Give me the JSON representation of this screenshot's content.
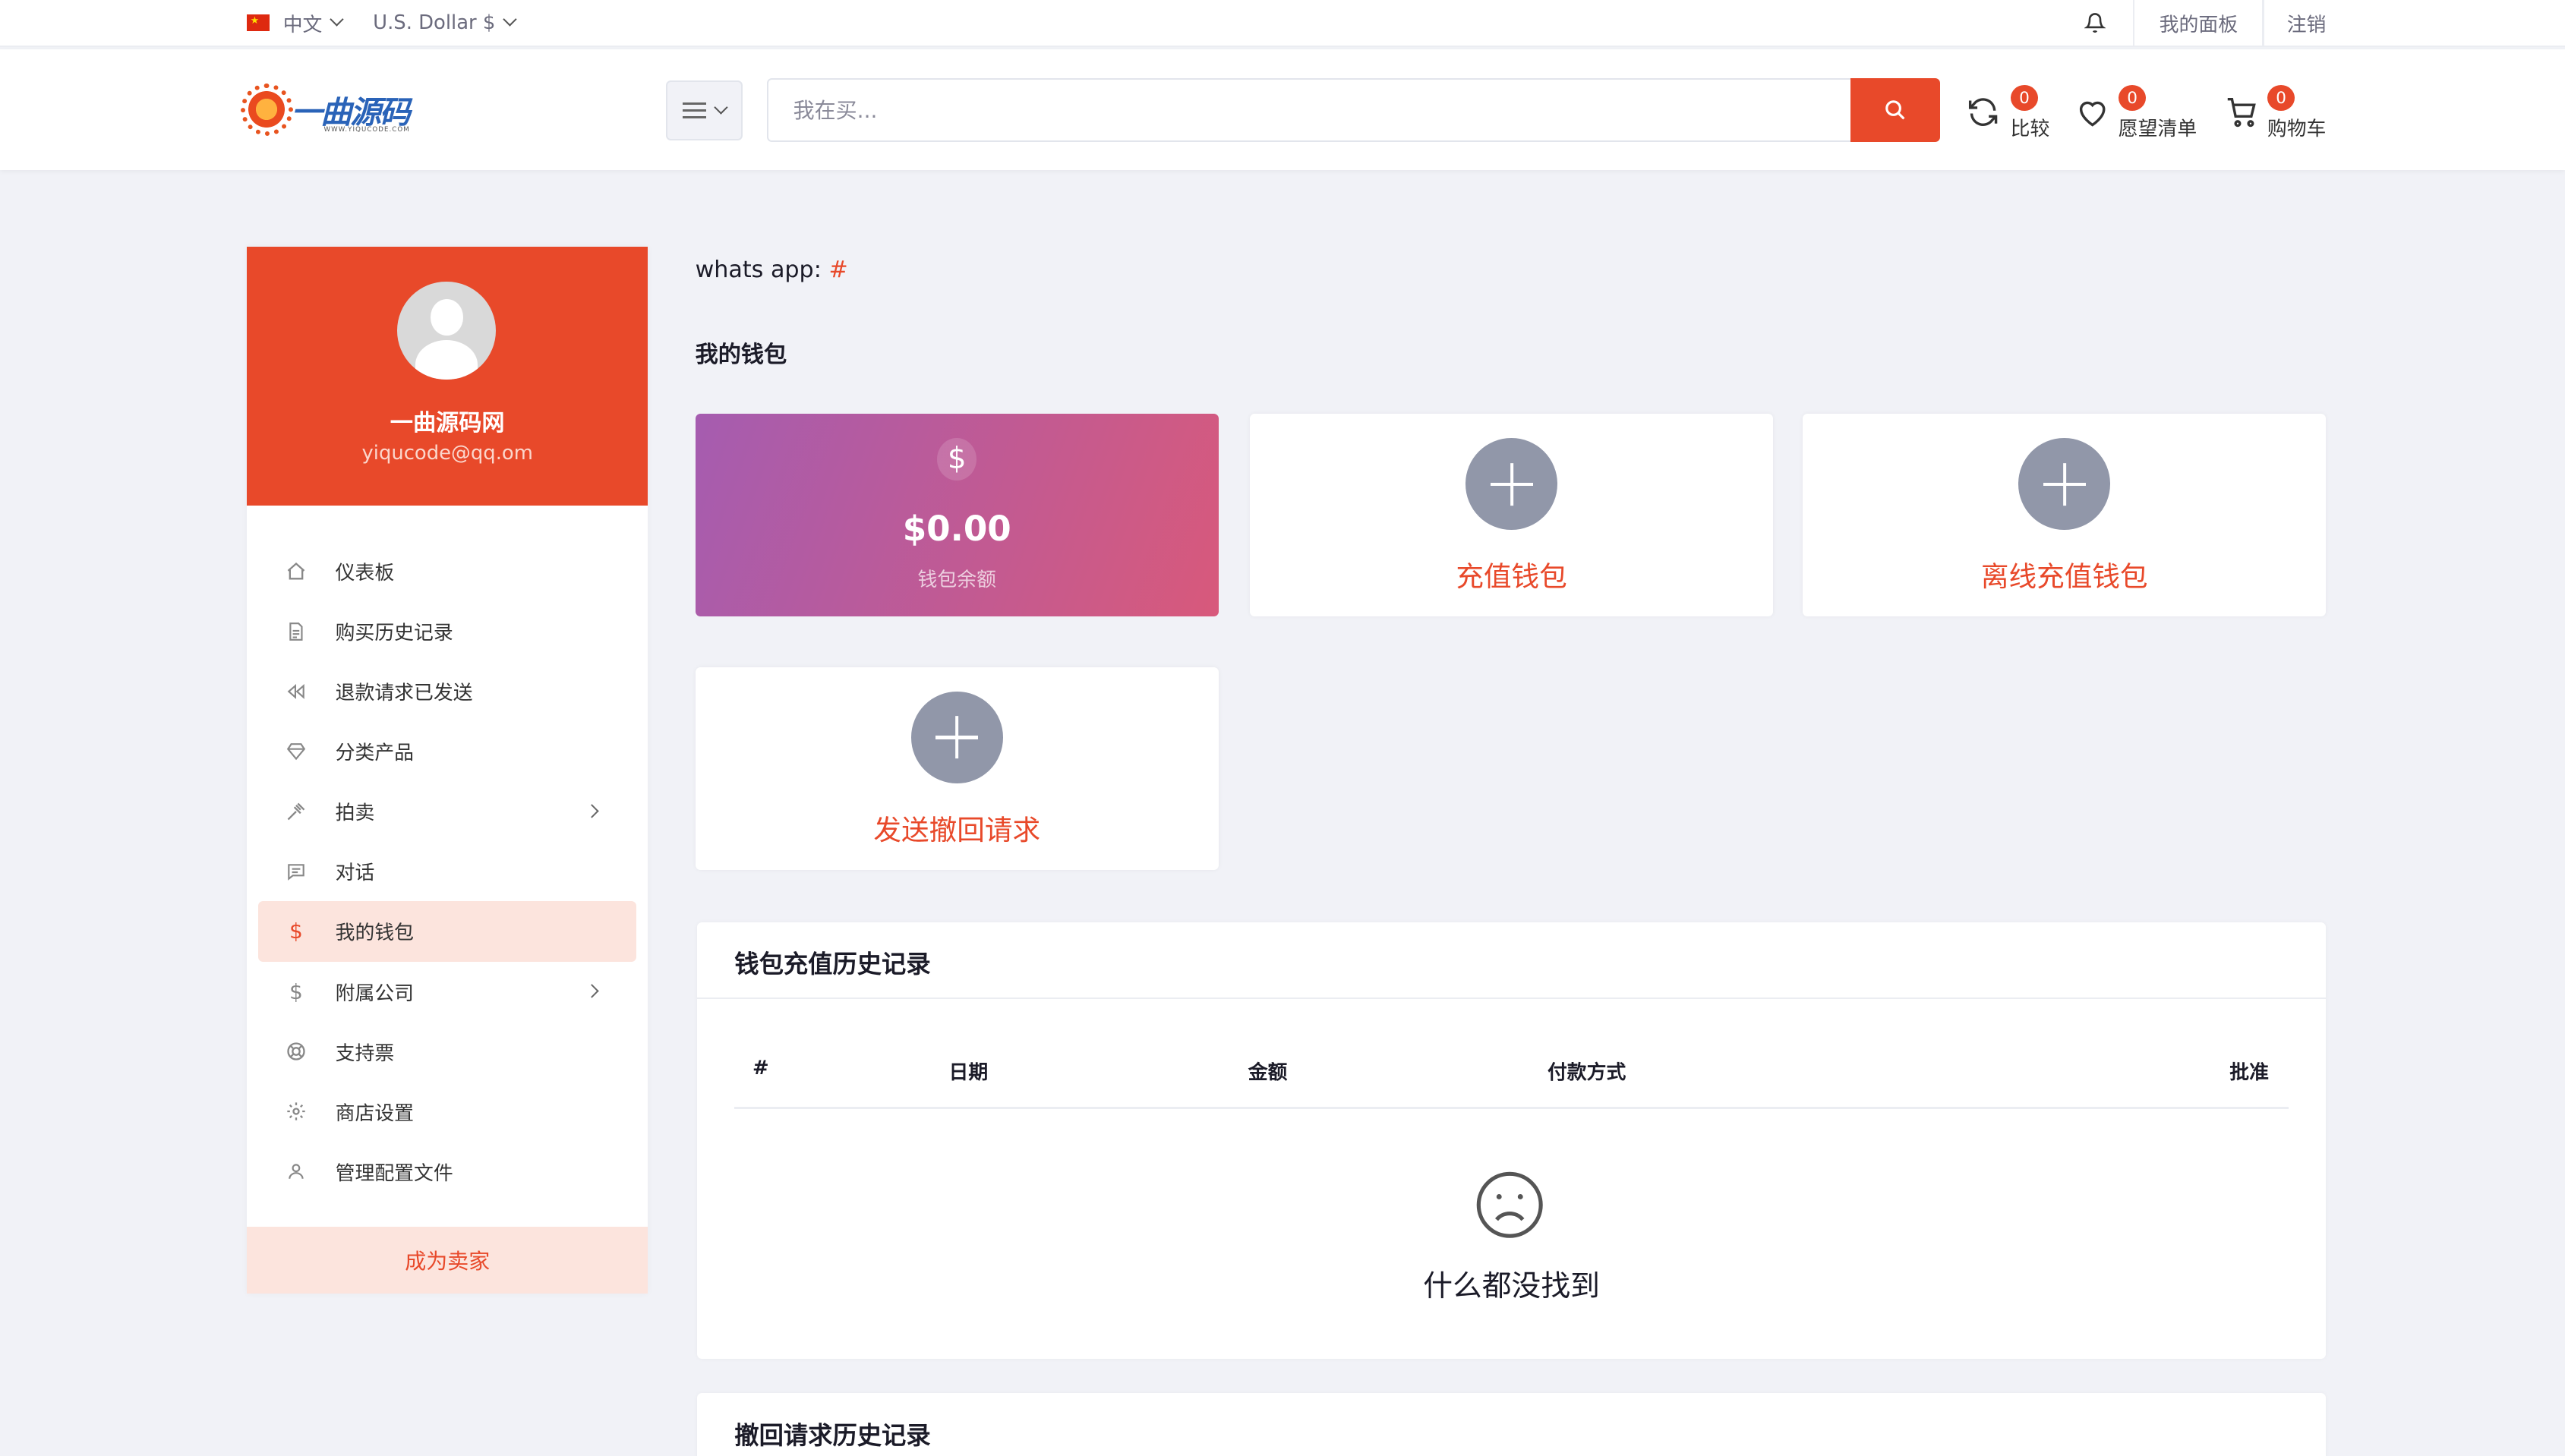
{
  "topbar": {
    "language": "中文",
    "currency": "U.S. Dollar $",
    "dashboard_link": "我的面板",
    "logout_link": "注销"
  },
  "header": {
    "logo_text": "一曲源码",
    "logo_sub": "WWW.YIQUCODE.COM",
    "search_placeholder": "我在买...",
    "compare": {
      "count": "0",
      "label": "比较"
    },
    "wishlist": {
      "count": "0",
      "label": "愿望清单"
    },
    "cart": {
      "count": "0",
      "label": "购物车"
    }
  },
  "sidebar": {
    "user_name": "一曲源码网",
    "user_email": "yiqucode@qq.om",
    "items": [
      {
        "label": "仪表板",
        "icon": "home-icon"
      },
      {
        "label": "购买历史记录",
        "icon": "file-icon"
      },
      {
        "label": "退款请求已发送",
        "icon": "rewind-icon"
      },
      {
        "label": "分类产品",
        "icon": "diamond-icon"
      },
      {
        "label": "拍卖",
        "icon": "gavel-icon"
      },
      {
        "label": "对话",
        "icon": "message-icon"
      },
      {
        "label": "我的钱包",
        "icon": "dollar-icon"
      },
      {
        "label": "附属公司",
        "icon": "dollar-icon"
      },
      {
        "label": "支持票",
        "icon": "support-icon"
      },
      {
        "label": "商店设置",
        "icon": "gear-icon"
      },
      {
        "label": "管理配置文件",
        "icon": "user-icon"
      }
    ],
    "become_seller": "成为卖家"
  },
  "main": {
    "whatsapp_label": "whats app:",
    "whatsapp_value": "#",
    "wallet_title": "我的钱包",
    "balance_symbol": "$",
    "balance_amount": "$0.00",
    "balance_label": "钱包余额",
    "recharge_label": "充值钱包",
    "offline_recharge_label": "离线充值钱包",
    "withdraw_label": "发送撤回请求",
    "recharge_history": {
      "title": "钱包充值历史记录",
      "columns": [
        "#",
        "日期",
        "金额",
        "付款方式",
        "批准"
      ],
      "empty_text": "什么都没找到"
    },
    "withdraw_history": {
      "title": "撤回请求历史记录"
    }
  },
  "colors": {
    "accent": "#e8492a",
    "balance_gradient_start": "#a55cb0",
    "balance_gradient_end": "#d8597b",
    "plus_circle": "#9197a9"
  }
}
